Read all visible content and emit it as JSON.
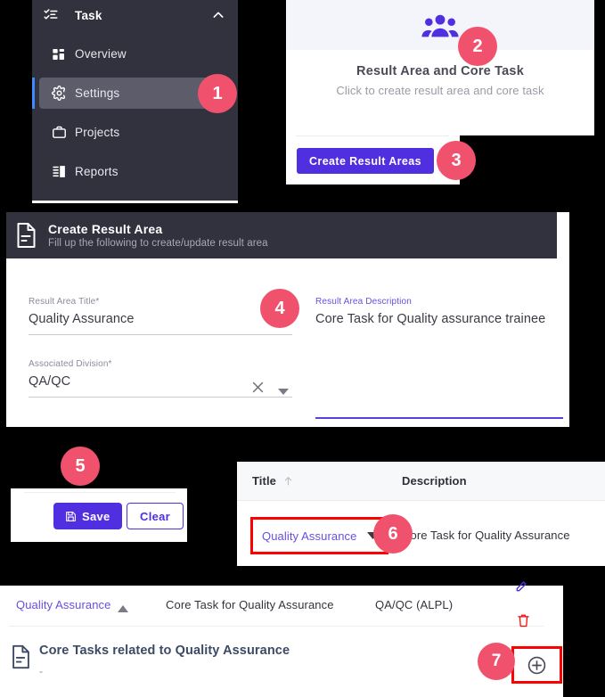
{
  "sidebar": {
    "header": {
      "label": "Task",
      "icon": "task-list-icon",
      "collapse_icon": "chevron-up-icon"
    },
    "items": [
      {
        "label": "Overview",
        "icon": "grid-icon",
        "active": false
      },
      {
        "label": "Settings",
        "icon": "gear-icon",
        "active": true
      },
      {
        "label": "Projects",
        "icon": "briefcase-icon",
        "active": false
      },
      {
        "label": "Reports",
        "icon": "report-icon",
        "active": false
      }
    ]
  },
  "card": {
    "icon": "people-group-icon",
    "title": "Result Area and Core Task",
    "subtitle": "Click to create result area and core task",
    "button_label": "Create Result Areas"
  },
  "form": {
    "icon": "document-icon",
    "title": "Create Result Area",
    "subtitle": "Fill up the following to create/update result area",
    "fields": {
      "title": {
        "label": "Result Area Title*",
        "value": "Quality Assurance"
      },
      "division": {
        "label": "Associated Division*",
        "value": "QA/QC",
        "clear_icon": "close-x-icon",
        "dropdown_icon": "caret-down-icon"
      },
      "description": {
        "label": "Result Area Description",
        "value": "Core Task for Quality assurance trainee"
      }
    }
  },
  "actions": {
    "save_label": "Save",
    "save_icon": "floppy-save-icon",
    "clear_label": "Clear"
  },
  "table": {
    "columns": [
      "Title",
      "Description"
    ],
    "sort_icon": "sort-asc-arrow-icon",
    "selected_title": "Quality Assurance",
    "dropdown_icon": "caret-down-icon",
    "row_description": "Core Task for Quality Assurance"
  },
  "bottom": {
    "row": {
      "title": "Quality Assurance",
      "sort_icon": "sort-asc-triangle-icon",
      "description": "Core Task for Quality Assurance",
      "division": "QA/QC (ALPL)",
      "edit_icon": "pencil-edit-icon",
      "delete_icon": "trash-delete-icon"
    },
    "section": {
      "icon": "document-icon",
      "title": "Core Tasks related to Quality Assurance",
      "subtitle": "-",
      "add_icon": "plus-circle-icon"
    }
  },
  "badges": [
    {
      "number": "1"
    },
    {
      "number": "2"
    },
    {
      "number": "3"
    },
    {
      "number": "4"
    },
    {
      "number": "5"
    },
    {
      "number": "6"
    },
    {
      "number": "7"
    }
  ],
  "colors": {
    "badge": "#f0526d",
    "primary": "#4f2fe0",
    "sidebar": "#32323f",
    "highlight": "#ff0000"
  }
}
